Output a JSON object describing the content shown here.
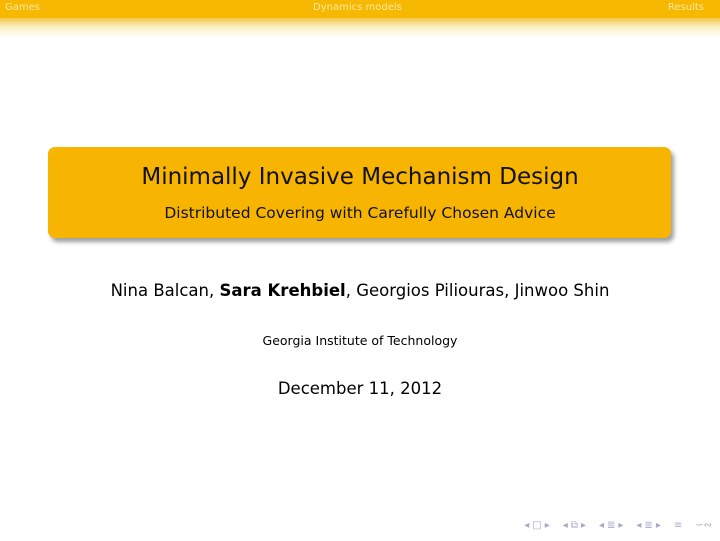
{
  "nav": {
    "sections": [
      "Games",
      "Dynamics models",
      "Results"
    ]
  },
  "title": {
    "main": "Minimally Invasive Mechanism Design",
    "subtitle": "Distributed Covering with Carefully Chosen Advice"
  },
  "authors": {
    "before": "Nina Balcan, ",
    "highlight": "Sara Krehbiel",
    "after": ", Georgios Piliouras, Jinwoo Shin"
  },
  "institute": "Georgia Institute of Technology",
  "date": "December 11, 2012",
  "beamer_nav_icons": [
    "prev-frame-icon",
    "frame-icon",
    "next-frame-icon",
    "prev-subsection-icon",
    "subsection-icon",
    "next-subsection-icon",
    "prev-section-icon",
    "section-icon",
    "next-section-icon",
    "prev-slide-icon",
    "slide-icon",
    "next-slide-icon",
    "align-icon",
    "search-icon"
  ],
  "colors": {
    "navbar": "#f6b800",
    "title_box": "#f7b400",
    "nav_text": "#fde9a3",
    "nav_icons": "#a9a9c4"
  }
}
